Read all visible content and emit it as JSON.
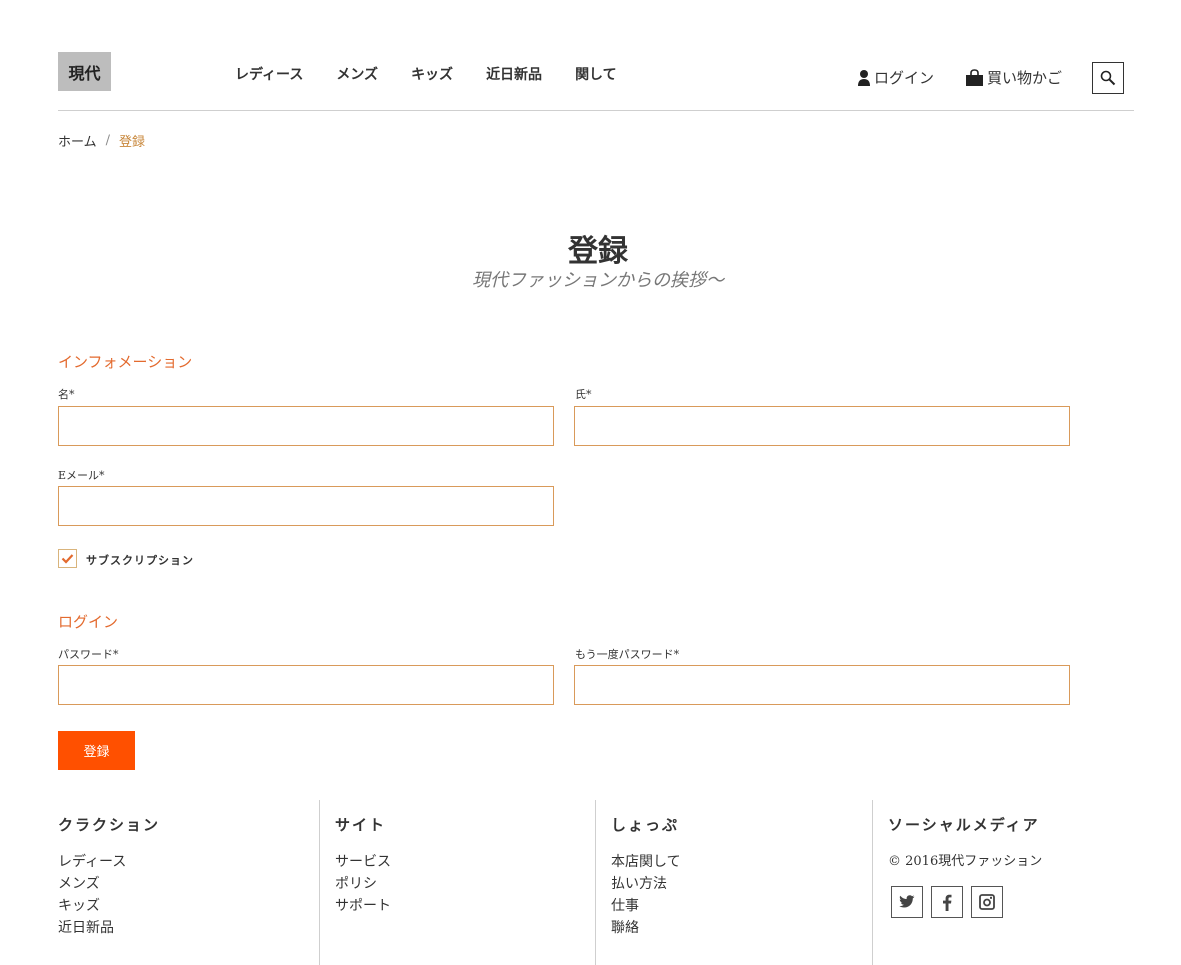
{
  "header": {
    "logo": "現代",
    "nav": [
      "レディース",
      "メンズ",
      "キッズ",
      "近日新品",
      "関して"
    ],
    "login_label": "ログイン",
    "cart_label": "買い物かご",
    "icons": {
      "login": "user-icon",
      "cart": "shopping-bag-icon",
      "search": "search-icon"
    }
  },
  "breadcrumb": {
    "home": "ホーム",
    "separator": "/",
    "current": "登録"
  },
  "page": {
    "title": "登録",
    "subtitle": "現代ファッションからの挨拶〜"
  },
  "info_section": {
    "title": "インフォメーション",
    "first_name_label": "名*",
    "last_name_label": "氏*",
    "email_label": "Eメール*",
    "first_name_value": "",
    "last_name_value": "",
    "email_value": ""
  },
  "subscription": {
    "label": "サブスクリプション",
    "checked": true
  },
  "login_section": {
    "title": "ログイン",
    "password_label": "パスワード*",
    "password_confirm_label": "もう一度パスワード*",
    "password_value": "",
    "password_confirm_value": ""
  },
  "submit_label": "登録",
  "footer": {
    "collection": {
      "heading": "クラクション",
      "links": [
        "レディース",
        "メンズ",
        "キッズ",
        "近日新品"
      ]
    },
    "site": {
      "heading": "サイト",
      "links": [
        "サービス",
        "ポリシ",
        "サポート"
      ]
    },
    "shop": {
      "heading": "しょっぷ",
      "links": [
        "本店関して",
        "払い方法",
        "仕事",
        "聯絡"
      ]
    },
    "social": {
      "heading": "ソーシャルメディア",
      "copyright": "© 2016現代ファッション",
      "icons": [
        "twitter-icon",
        "facebook-icon",
        "instagram-icon"
      ]
    }
  },
  "colors": {
    "accent": "#ff5000",
    "section_title": "#e36a2e",
    "field_border": "#d99a5a",
    "breadcrumb_current": "#c8873b"
  }
}
